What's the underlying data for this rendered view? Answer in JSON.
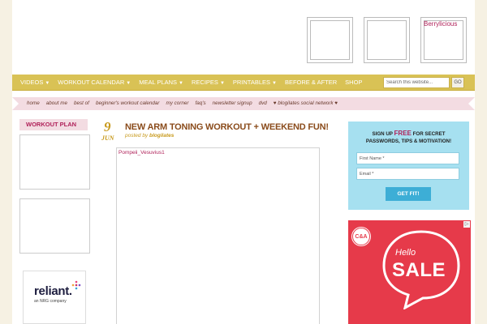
{
  "header": {
    "ad_label": "Berrylicious"
  },
  "nav": {
    "items": [
      {
        "label": "Videos",
        "dropdown": true
      },
      {
        "label": "Workout Calendar",
        "dropdown": true
      },
      {
        "label": "Meal Plans",
        "dropdown": true
      },
      {
        "label": "Recipes",
        "dropdown": true
      },
      {
        "label": "Printables",
        "dropdown": true
      },
      {
        "label": "Before & After",
        "dropdown": false
      },
      {
        "label": "Shop",
        "dropdown": false
      }
    ],
    "search_placeholder": "Search this website...",
    "search_button": "GO"
  },
  "subnav": {
    "items": [
      "home",
      "about me",
      "best of",
      "beginner's workout calendar",
      "my corner",
      "faq's",
      "newsletter signup",
      "dvd",
      "♥ blogilates social network ♥"
    ]
  },
  "sidebar_left": {
    "title": "WORKOUT PLAN",
    "sponsor_name": "reliant.",
    "sponsor_sub": "an NRG company"
  },
  "post": {
    "day": "9",
    "month": "JUN",
    "title": "NEW ARM TONING WORKOUT + WEEKEND FUN!",
    "meta_prefix": "posted by",
    "author": "blogilates",
    "embed_label": "Pompeii_Vesuvius1"
  },
  "signup": {
    "line1_pre": "SIGN UP ",
    "line1_free": "FREE",
    "line1_post": " FOR SECRET",
    "line2": "PASSWORDS, TIPS & MOTIVATION!",
    "first_name_placeholder": "First Name *",
    "email_placeholder": "Email *",
    "button": "GET FIT!"
  },
  "ad": {
    "brand": "C&A",
    "hello": "Hello",
    "sale": "SALE",
    "badge": "▷"
  },
  "colors": {
    "nav_bg": "#d9c255",
    "accent_pink": "#b0225a",
    "gold": "#c89a1d",
    "signup_bg": "#a6e0f0",
    "button_blue": "#3daed6",
    "ad_red": "#e63a4a"
  }
}
